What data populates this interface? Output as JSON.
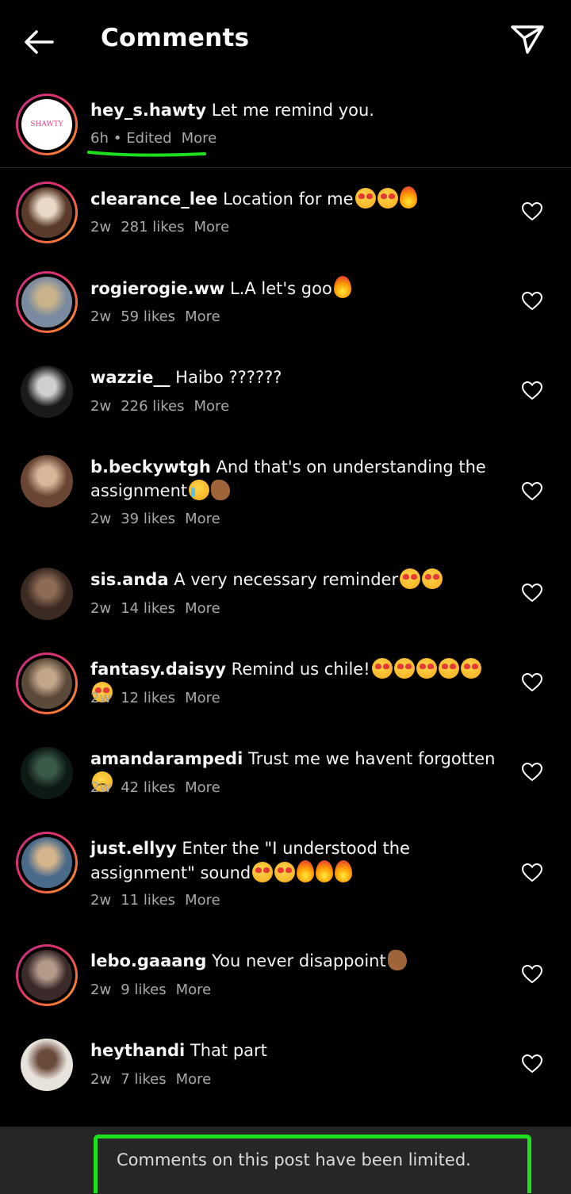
{
  "header": {
    "title": "Comments"
  },
  "caption": {
    "username": "hey_s.hawty",
    "text": "Let me remind you.",
    "time": "6h",
    "edited": "• Edited",
    "more": "More",
    "avatar_text": "SHAWTY"
  },
  "comments": [
    {
      "username": "clearance_lee",
      "text": "Location for me",
      "emojis": [
        "heart-eyes",
        "heart-eyes",
        "fire"
      ],
      "time": "2w",
      "likes": "281 likes",
      "more": "More"
    },
    {
      "username": "rogierogie.ww",
      "text": "L.A let's goo",
      "emojis": [
        "fire"
      ],
      "time": "2w",
      "likes": "59 likes",
      "more": "More"
    },
    {
      "username": "wazzie__",
      "text": "Haibo ??????",
      "emojis": [],
      "time": "2w",
      "likes": "226 likes",
      "more": "More"
    },
    {
      "username": "b.beckywtgh",
      "text": "And that's on understanding the assignment",
      "emojis": [
        "cry",
        "pinch"
      ],
      "time": "2w",
      "likes": "39 likes",
      "more": "More"
    },
    {
      "username": "sis.anda",
      "text": "A very necessary reminder",
      "emojis": [
        "heart-eyes",
        "heart-eyes"
      ],
      "time": "2w",
      "likes": "14 likes",
      "more": "More"
    },
    {
      "username": "fantasy.daisyy",
      "text": "Remind us chile!",
      "emojis": [
        "heart-eyes",
        "heart-eyes",
        "heart-eyes",
        "heart-eyes",
        "heart-eyes",
        "heart-eyes"
      ],
      "time": "2w",
      "likes": "12 likes",
      "more": "More"
    },
    {
      "username": "amandarampedi",
      "text": "Trust me we havent forgotten",
      "emojis": [
        "sad"
      ],
      "time": "2w",
      "likes": "42 likes",
      "more": "More"
    },
    {
      "username": "just.ellyy",
      "text": "Enter the \"I understood the assignment\" sound",
      "emojis": [
        "heart-eyes",
        "heart-eyes",
        "fire",
        "fire",
        "fire"
      ],
      "time": "2w",
      "likes": "11 likes",
      "more": "More"
    },
    {
      "username": "lebo.gaaang",
      "text": "You never disappoint",
      "emojis": [
        "pinch"
      ],
      "time": "2w",
      "likes": "9 likes",
      "more": "More"
    },
    {
      "username": "heythandi",
      "text": "That part",
      "emojis": [],
      "time": "2w",
      "likes": "7 likes",
      "more": "More"
    }
  ],
  "footer": {
    "text": "Comments on this post have been limited."
  },
  "colors": {
    "background": "#000000",
    "meta_text": "#a8a8a8",
    "highlight": "#1fe01f",
    "footer_bg": "#262626"
  }
}
